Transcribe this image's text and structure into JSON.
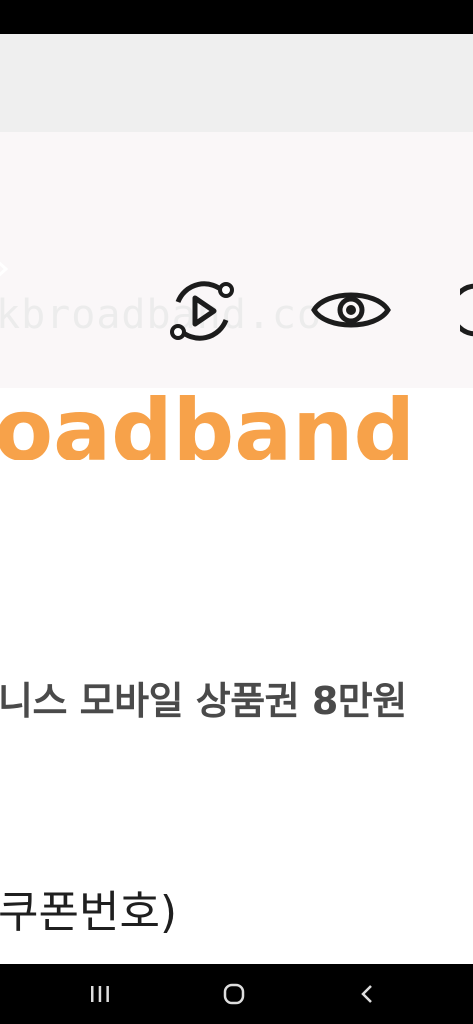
{
  "watermark": {
    "text": "kbroadband.co"
  },
  "brand": {
    "text": "oadband"
  },
  "content": {
    "headline": "니스 모바일 상품권 8만원",
    "coupon_line": "쿠폰번호)"
  },
  "icons": {
    "left": "chevron-right-icon",
    "replay": "replay-play-icon",
    "eye": "eye-icon"
  },
  "colors": {
    "brand": "#f7a24a",
    "text": "#4a4a4a"
  },
  "navigation": {
    "recents": "recent-apps-icon",
    "home": "home-icon",
    "back": "back-icon"
  }
}
